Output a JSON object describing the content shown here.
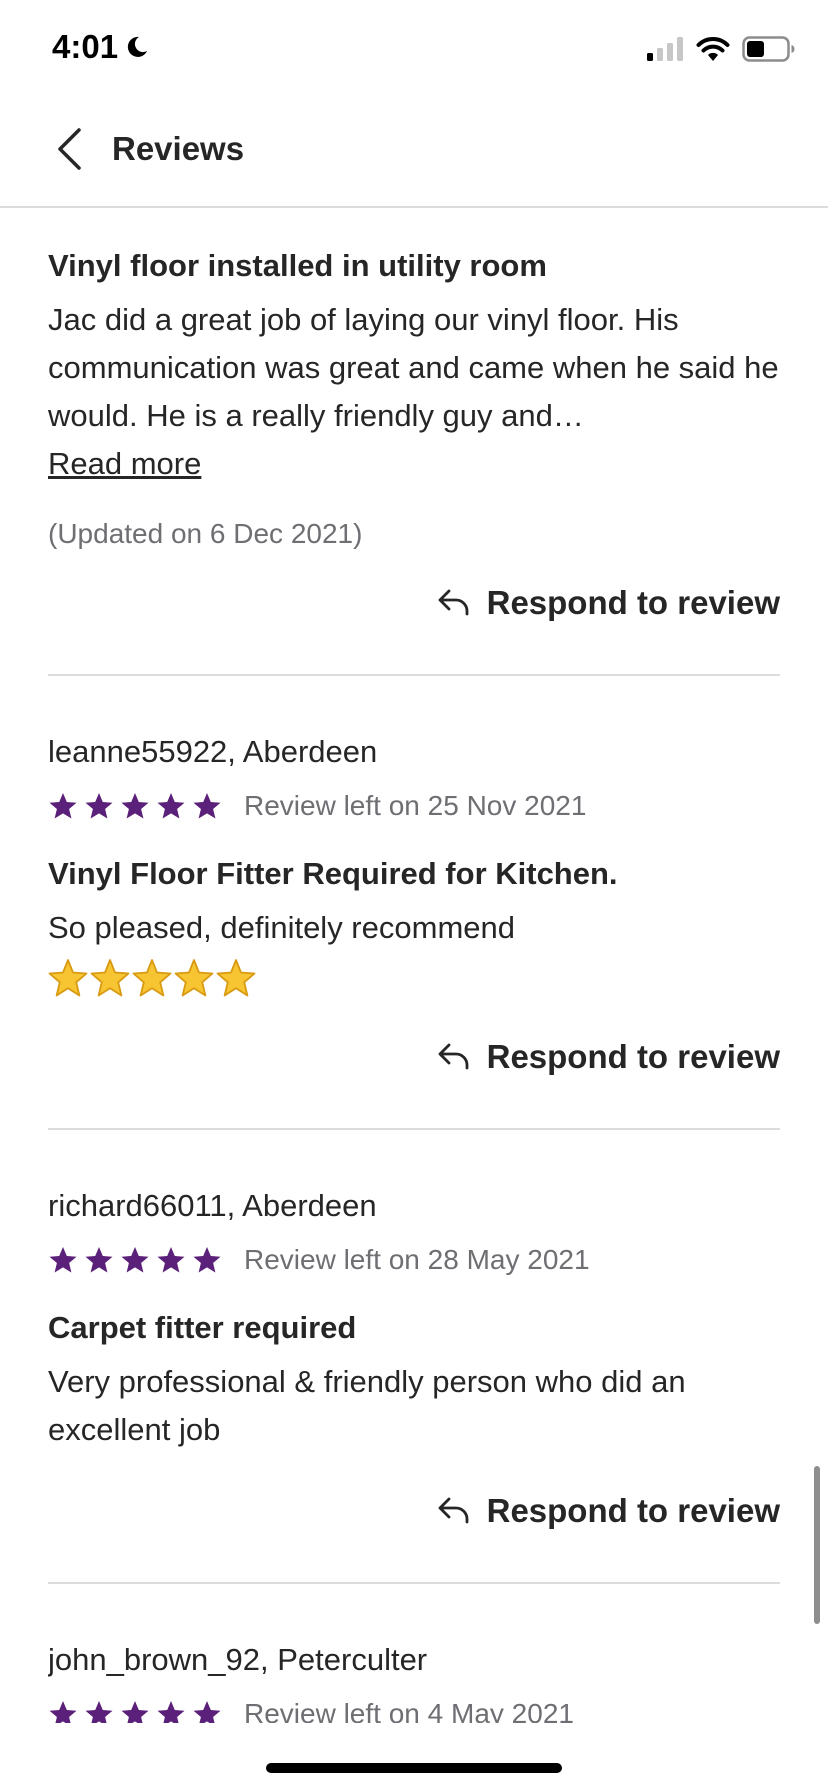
{
  "status_bar": {
    "time": "4:01",
    "icons": [
      "moon-icon",
      "signal-icon",
      "wifi-icon",
      "battery-icon"
    ]
  },
  "header": {
    "title": "Reviews",
    "back_icon": "chevron-left-icon"
  },
  "respond_label": "Respond to review",
  "colors": {
    "star_purple": "#5b2079",
    "emoji_star_gold": "#f7c531",
    "divider": "#dcdcdc",
    "muted_text": "#6e6e73"
  },
  "reviews": [
    {
      "title": "Vinyl floor installed in utility room",
      "body": "Jac did a great job of laying our vinyl floor. His communication was great and came when he said he would. He is a really friendly guy and…",
      "read_more": "Read more",
      "updated": "(Updated on 6 Dec 2021)"
    },
    {
      "reviewer": "leanne55922, Aberdeen",
      "stars": 5,
      "date": "Review left on 25 Nov 2021",
      "title": "Vinyl Floor Fitter Required for Kitchen.",
      "body": "So pleased, definitely recommend",
      "emoji_stars": 5
    },
    {
      "reviewer": "richard66011, Aberdeen",
      "stars": 5,
      "date": "Review left on 28 May 2021",
      "title": "Carpet fitter required",
      "body": "Very professional & friendly person who did an excellent job"
    },
    {
      "reviewer": "john_brown_92, Peterculter",
      "stars": 5,
      "date": "Review left on 4 May 2021"
    }
  ]
}
